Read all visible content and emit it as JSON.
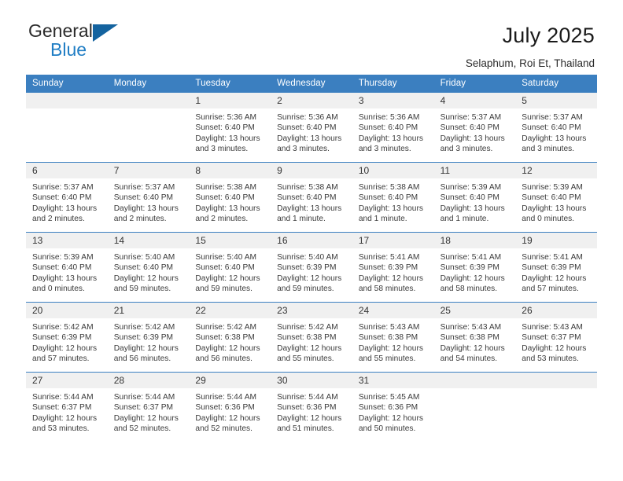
{
  "brand": {
    "name_line1": "General",
    "name_line2": "Blue",
    "accent_color": "#14639f",
    "blue_text_color": "#1f7dc4"
  },
  "header": {
    "title": "July 2025",
    "subtitle": "Selaphum, Roi Et, Thailand"
  },
  "calendar": {
    "header_bg": "#3b7fc0",
    "daynum_bg": "#f0f0f0",
    "weekdays": [
      "Sunday",
      "Monday",
      "Tuesday",
      "Wednesday",
      "Thursday",
      "Friday",
      "Saturday"
    ],
    "weeks": [
      [
        {
          "day": "",
          "details": ""
        },
        {
          "day": "",
          "details": ""
        },
        {
          "day": "1",
          "details": "Sunrise: 5:36 AM\nSunset: 6:40 PM\nDaylight: 13 hours\nand 3 minutes."
        },
        {
          "day": "2",
          "details": "Sunrise: 5:36 AM\nSunset: 6:40 PM\nDaylight: 13 hours\nand 3 minutes."
        },
        {
          "day": "3",
          "details": "Sunrise: 5:36 AM\nSunset: 6:40 PM\nDaylight: 13 hours\nand 3 minutes."
        },
        {
          "day": "4",
          "details": "Sunrise: 5:37 AM\nSunset: 6:40 PM\nDaylight: 13 hours\nand 3 minutes."
        },
        {
          "day": "5",
          "details": "Sunrise: 5:37 AM\nSunset: 6:40 PM\nDaylight: 13 hours\nand 3 minutes."
        }
      ],
      [
        {
          "day": "6",
          "details": "Sunrise: 5:37 AM\nSunset: 6:40 PM\nDaylight: 13 hours\nand 2 minutes."
        },
        {
          "day": "7",
          "details": "Sunrise: 5:37 AM\nSunset: 6:40 PM\nDaylight: 13 hours\nand 2 minutes."
        },
        {
          "day": "8",
          "details": "Sunrise: 5:38 AM\nSunset: 6:40 PM\nDaylight: 13 hours\nand 2 minutes."
        },
        {
          "day": "9",
          "details": "Sunrise: 5:38 AM\nSunset: 6:40 PM\nDaylight: 13 hours\nand 1 minute."
        },
        {
          "day": "10",
          "details": "Sunrise: 5:38 AM\nSunset: 6:40 PM\nDaylight: 13 hours\nand 1 minute."
        },
        {
          "day": "11",
          "details": "Sunrise: 5:39 AM\nSunset: 6:40 PM\nDaylight: 13 hours\nand 1 minute."
        },
        {
          "day": "12",
          "details": "Sunrise: 5:39 AM\nSunset: 6:40 PM\nDaylight: 13 hours\nand 0 minutes."
        }
      ],
      [
        {
          "day": "13",
          "details": "Sunrise: 5:39 AM\nSunset: 6:40 PM\nDaylight: 13 hours\nand 0 minutes."
        },
        {
          "day": "14",
          "details": "Sunrise: 5:40 AM\nSunset: 6:40 PM\nDaylight: 12 hours\nand 59 minutes."
        },
        {
          "day": "15",
          "details": "Sunrise: 5:40 AM\nSunset: 6:40 PM\nDaylight: 12 hours\nand 59 minutes."
        },
        {
          "day": "16",
          "details": "Sunrise: 5:40 AM\nSunset: 6:39 PM\nDaylight: 12 hours\nand 59 minutes."
        },
        {
          "day": "17",
          "details": "Sunrise: 5:41 AM\nSunset: 6:39 PM\nDaylight: 12 hours\nand 58 minutes."
        },
        {
          "day": "18",
          "details": "Sunrise: 5:41 AM\nSunset: 6:39 PM\nDaylight: 12 hours\nand 58 minutes."
        },
        {
          "day": "19",
          "details": "Sunrise: 5:41 AM\nSunset: 6:39 PM\nDaylight: 12 hours\nand 57 minutes."
        }
      ],
      [
        {
          "day": "20",
          "details": "Sunrise: 5:42 AM\nSunset: 6:39 PM\nDaylight: 12 hours\nand 57 minutes."
        },
        {
          "day": "21",
          "details": "Sunrise: 5:42 AM\nSunset: 6:39 PM\nDaylight: 12 hours\nand 56 minutes."
        },
        {
          "day": "22",
          "details": "Sunrise: 5:42 AM\nSunset: 6:38 PM\nDaylight: 12 hours\nand 56 minutes."
        },
        {
          "day": "23",
          "details": "Sunrise: 5:42 AM\nSunset: 6:38 PM\nDaylight: 12 hours\nand 55 minutes."
        },
        {
          "day": "24",
          "details": "Sunrise: 5:43 AM\nSunset: 6:38 PM\nDaylight: 12 hours\nand 55 minutes."
        },
        {
          "day": "25",
          "details": "Sunrise: 5:43 AM\nSunset: 6:38 PM\nDaylight: 12 hours\nand 54 minutes."
        },
        {
          "day": "26",
          "details": "Sunrise: 5:43 AM\nSunset: 6:37 PM\nDaylight: 12 hours\nand 53 minutes."
        }
      ],
      [
        {
          "day": "27",
          "details": "Sunrise: 5:44 AM\nSunset: 6:37 PM\nDaylight: 12 hours\nand 53 minutes."
        },
        {
          "day": "28",
          "details": "Sunrise: 5:44 AM\nSunset: 6:37 PM\nDaylight: 12 hours\nand 52 minutes."
        },
        {
          "day": "29",
          "details": "Sunrise: 5:44 AM\nSunset: 6:36 PM\nDaylight: 12 hours\nand 52 minutes."
        },
        {
          "day": "30",
          "details": "Sunrise: 5:44 AM\nSunset: 6:36 PM\nDaylight: 12 hours\nand 51 minutes."
        },
        {
          "day": "31",
          "details": "Sunrise: 5:45 AM\nSunset: 6:36 PM\nDaylight: 12 hours\nand 50 minutes."
        },
        {
          "day": "",
          "details": ""
        },
        {
          "day": "",
          "details": ""
        }
      ]
    ]
  }
}
